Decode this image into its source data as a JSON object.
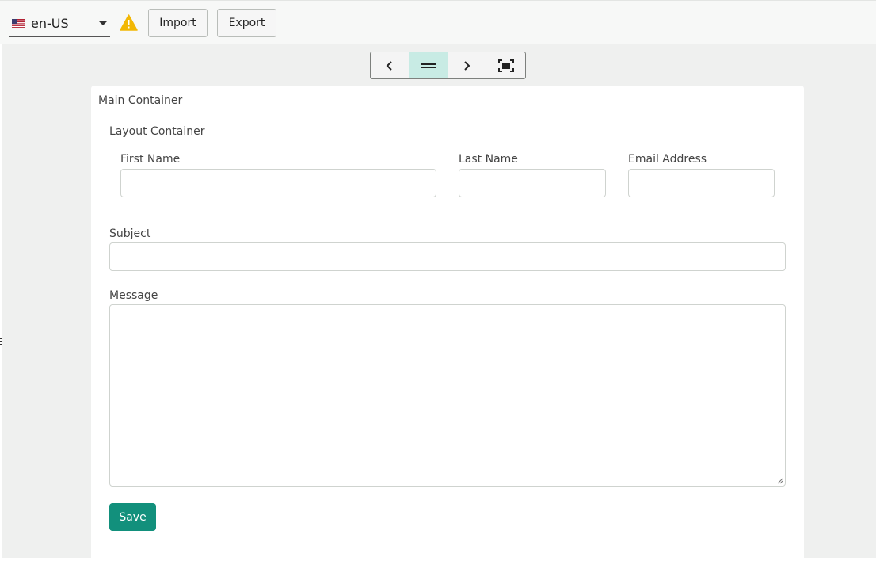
{
  "topbar": {
    "locale": "en-US",
    "locale_flag": "us-flag-icon",
    "warning_icon": "warning-icon",
    "warning_color": "#f2b705",
    "import_label": "Import",
    "export_label": "Export"
  },
  "toolbar": {
    "buttons": [
      {
        "icon": "chevron-left-icon"
      },
      {
        "icon": "equals-icon",
        "active": true
      },
      {
        "icon": "chevron-right-icon"
      },
      {
        "icon": "fullscreen-icon"
      }
    ],
    "active_color": "#c8ebe4"
  },
  "form": {
    "main_container_label": "Main Container",
    "layout_container_label": "Layout Container",
    "first_name_label": "First Name",
    "last_name_label": "Last Name",
    "email_label": "Email Address",
    "subject_label": "Subject",
    "message_label": "Message",
    "save_label": "Save",
    "accent_color": "#12907c"
  }
}
